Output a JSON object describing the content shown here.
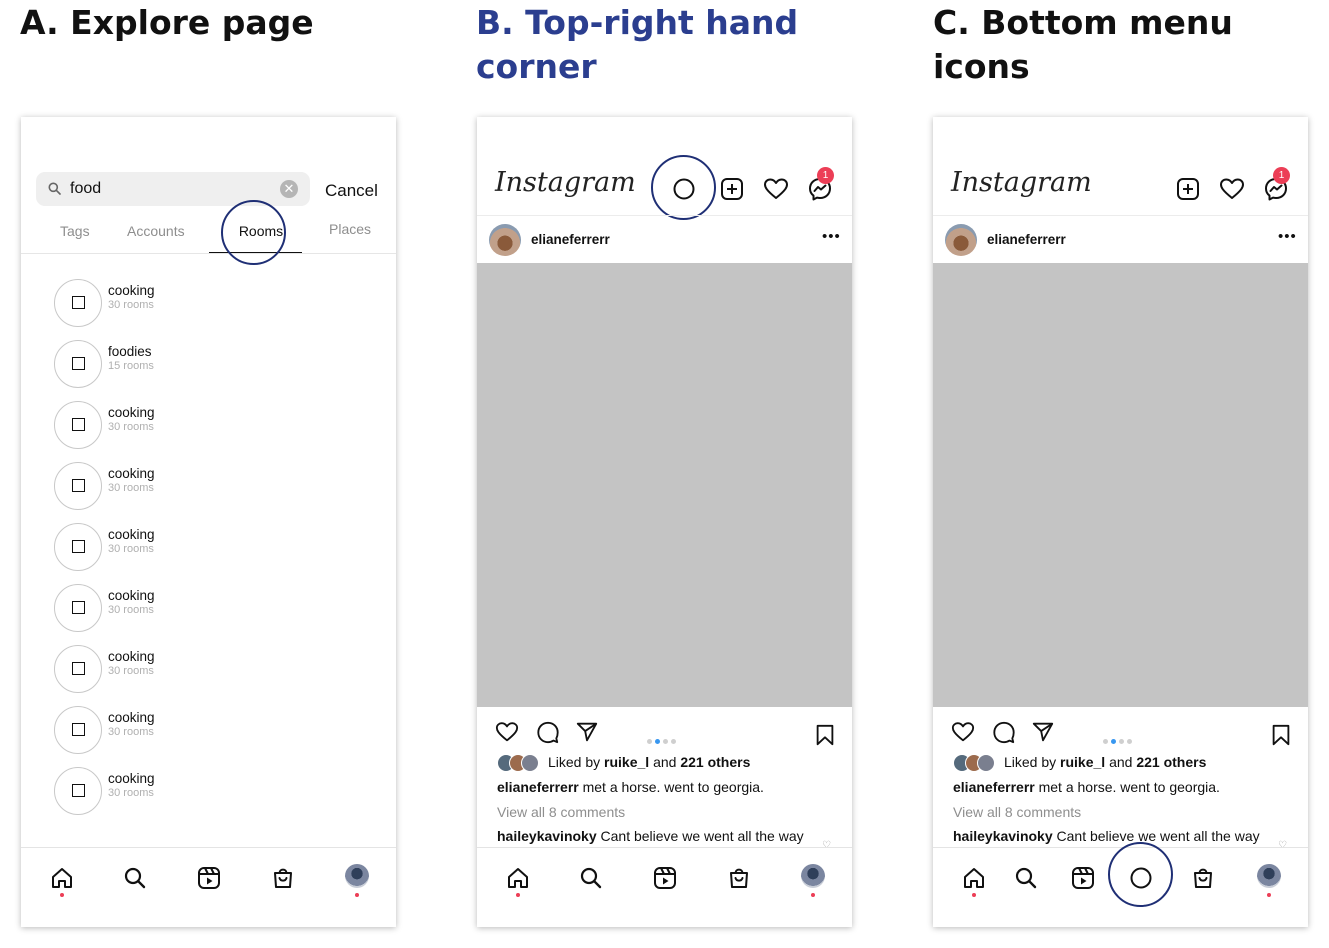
{
  "headings": {
    "a": "A. Explore page",
    "b": "B. Top-right hand corner",
    "c": "C. Bottom menu icons"
  },
  "colors": {
    "heading_b": "#2b3e8f",
    "highlight_ring": "#1f2f75",
    "badge": "#ec3e56",
    "image_placeholder": "#c4c4c4",
    "carousel_active_dot": "#3897f0"
  },
  "explore": {
    "search": {
      "value": "food",
      "icon": "search-icon",
      "clear_icon": "clear-icon"
    },
    "cancel_label": "Cancel",
    "tabs": [
      "Tags",
      "Accounts",
      "Rooms",
      "Places"
    ],
    "active_tab": "Rooms",
    "rooms": [
      {
        "name": "cooking",
        "count": "30 rooms"
      },
      {
        "name": "foodies",
        "count": "15 rooms"
      },
      {
        "name": "cooking",
        "count": "30 rooms"
      },
      {
        "name": "cooking",
        "count": "30 rooms"
      },
      {
        "name": "cooking",
        "count": "30 rooms"
      },
      {
        "name": "cooking",
        "count": "30 rooms"
      },
      {
        "name": "cooking",
        "count": "30 rooms"
      },
      {
        "name": "cooking",
        "count": "30 rooms"
      },
      {
        "name": "cooking",
        "count": "30 rooms"
      }
    ]
  },
  "feed": {
    "logo": "Instagram",
    "messenger_badge": "1",
    "post": {
      "username": "elianeferrerr",
      "more": "•••",
      "liked_prefix": "Liked by ",
      "liked_user": "ruike_l",
      "liked_mid": " and ",
      "liked_count": "221 others",
      "caption_user": "elianeferrerr",
      "caption_text": " met a horse. went to georgia.",
      "view_comments": "View all 8 comments",
      "comment_user": "haileykavinoky",
      "comment_text": " Cant believe we went all the way",
      "carousel_dots": 4,
      "carousel_active": 2
    }
  },
  "bottom_nav": [
    "home-icon",
    "search-icon",
    "reels-icon",
    "shop-icon",
    "profile-avatar"
  ]
}
